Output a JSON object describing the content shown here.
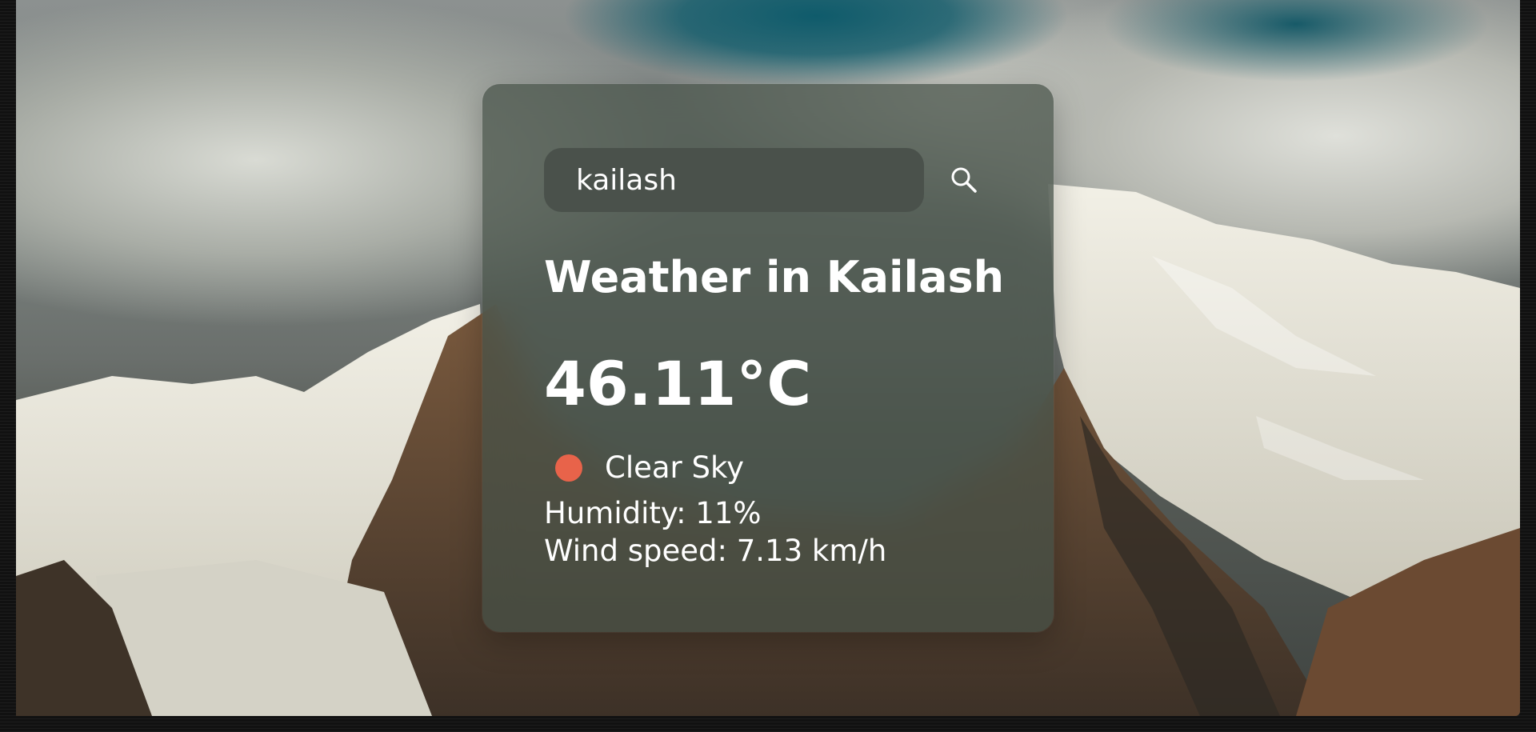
{
  "search": {
    "value": "kailash",
    "button_icon": "search-icon"
  },
  "weather": {
    "title": "Weather in Kailash",
    "temperature": "46.11°C",
    "condition": "Clear Sky",
    "condition_icon": "weather-dot-icon",
    "humidity": "Humidity: 11%",
    "wind": "Wind speed: 7.13 km/h"
  },
  "colors": {
    "card_background": "#465248",
    "input_background": "#4a514b",
    "text": "#ffffff",
    "condition_dot": "#e8634a"
  }
}
